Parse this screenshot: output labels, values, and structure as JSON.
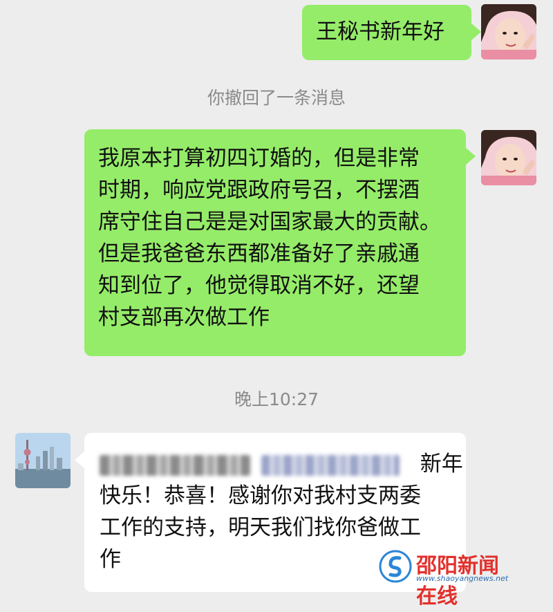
{
  "messages": [
    {
      "side": "right",
      "text": "王秘书新年好"
    },
    {
      "type": "system",
      "text": "你撤回了一条消息"
    },
    {
      "side": "right",
      "lines": [
        "我原本打算初四订婚的，但是非常",
        "时期，响应党跟政府号召，不摆酒",
        "席守住自己是是对国家最大的贡献。",
        "但是我爸爸东西都准备好了亲戚通",
        "知到位了，他觉得取消不好，还望",
        "村支部再次做工作"
      ]
    },
    {
      "type": "timestamp",
      "text": "晚上10:27"
    },
    {
      "side": "left",
      "first_line_suffix": "新年",
      "lines": [
        "快乐！恭喜！感谢你对我村支两委",
        "工作的支持，明天我们找你爸做工",
        "作"
      ]
    }
  ],
  "watermark": {
    "title": "邵阳新闻在线",
    "url": "www.shaoyangnews.net"
  },
  "colors": {
    "background": "#ededed",
    "sent_bubble": "#95ec69",
    "received_bubble": "#ffffff",
    "system_text": "#8a8a8a",
    "watermark_red": "#e2302c"
  }
}
